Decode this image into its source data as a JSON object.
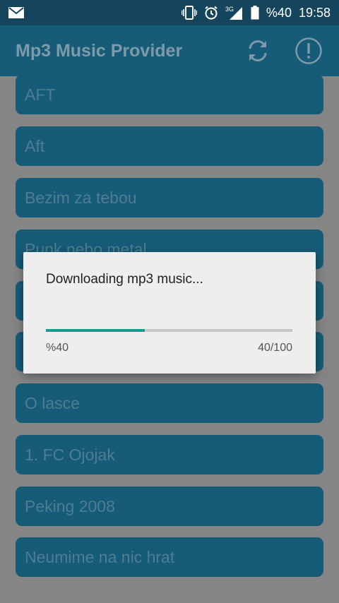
{
  "status_bar": {
    "battery_text": "%40",
    "time": "19:58",
    "network": "3G",
    "icons": [
      "mail-icon",
      "vibrate-icon",
      "alarm-icon",
      "signal-icon",
      "battery-icon"
    ]
  },
  "app_bar": {
    "title": "Mp3 Music Provider",
    "actions": [
      "refresh-icon",
      "info-icon"
    ]
  },
  "songs": [
    "AFT",
    "Aft",
    "Bezim za tebou",
    "Punk nebo metal",
    "",
    "",
    "O lasce",
    "1. FC Ojojak",
    "Peking 2008",
    "Neumime na nic hrat"
  ],
  "dialog": {
    "message": "Downloading mp3 music...",
    "percent_text": "%40",
    "count_text": "40/100",
    "progress": 0.4
  },
  "colors": {
    "primary": "#165b77",
    "accent": "#1a9a8c",
    "dialog_bg": "#eeeeee"
  }
}
